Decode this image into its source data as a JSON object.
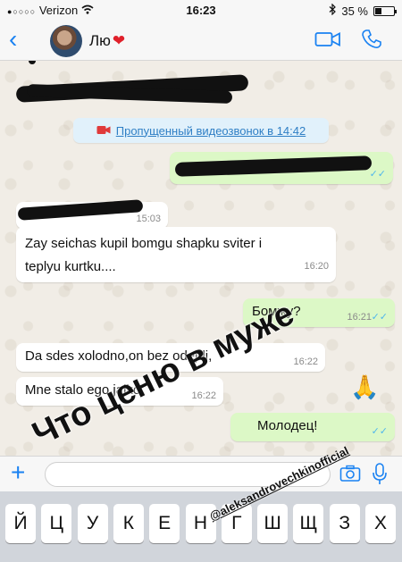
{
  "status": {
    "carrier": "Verizon",
    "time": "16:23",
    "battery": "35 %",
    "battery_level": 0.35
  },
  "header": {
    "contact_name": "Лю",
    "heart": "❤"
  },
  "chat": {
    "missed_call": "Пропущенный видеозвонок в 14:42",
    "messages": [
      {
        "direction": "out",
        "text": "",
        "time": ""
      },
      {
        "direction": "in",
        "text": "",
        "time": "15:03"
      },
      {
        "direction": "in",
        "text_line1": "Zay seichas kupil bomgu shapku sviter i",
        "text_line2": "teplyu kurtku....",
        "time": "16:20"
      },
      {
        "direction": "out",
        "text": "Бомжу?",
        "time": "16:21"
      },
      {
        "direction": "in",
        "text": "Da sdes xolodno,on bez odejdi,",
        "time": "16:22"
      },
      {
        "direction": "in",
        "text": "Mne stalo ego jalko",
        "time": "16:22"
      },
      {
        "direction": "out",
        "text": "Молодец!",
        "time": ""
      }
    ]
  },
  "input": {
    "placeholder": ""
  },
  "keyboard": {
    "row1": [
      "Й",
      "Ц",
      "У",
      "К",
      "Е",
      "Н",
      "Г",
      "Ш",
      "Щ",
      "З",
      "Х"
    ]
  },
  "overlay": {
    "caption": "Что ценю в муже",
    "handle": "@aleksandrovechkinofficial",
    "emoji": "🙏"
  },
  "colors": {
    "accent": "#1a82f2",
    "outgoing_bubble": "#dcf8c6",
    "read_ticks": "#4fb6ec"
  }
}
